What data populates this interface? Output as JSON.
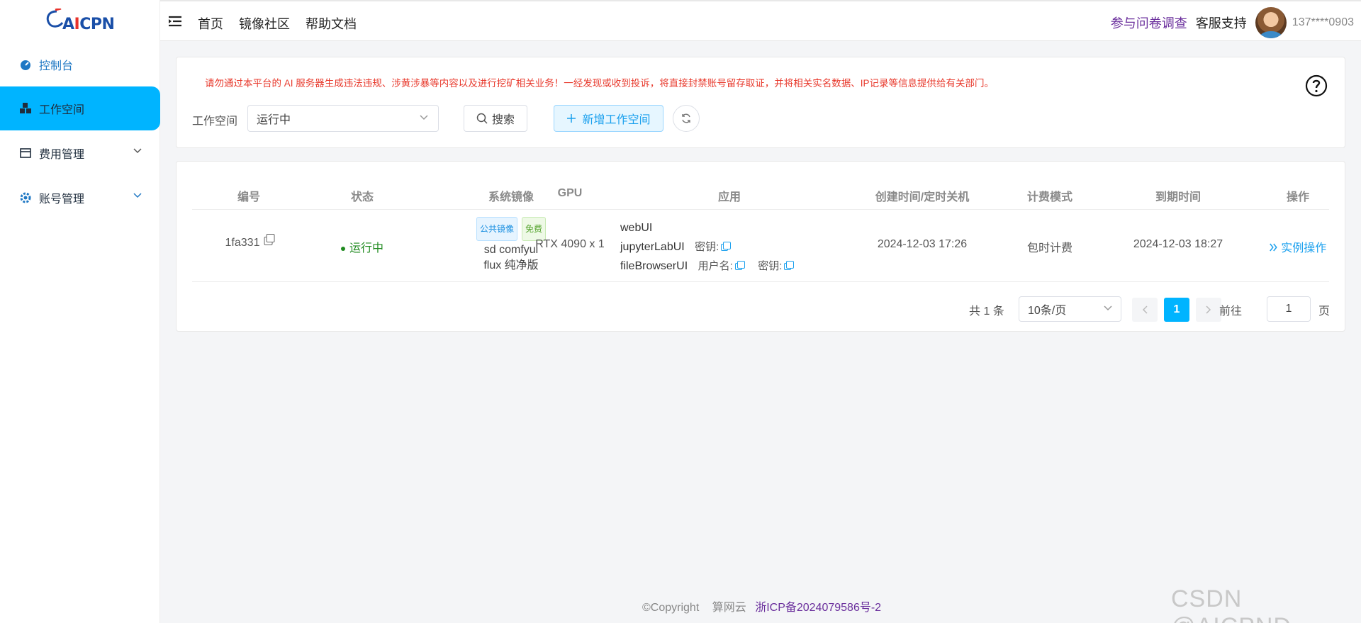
{
  "brand": {
    "logo_prefix": "A",
    "logo_red": "I",
    "logo_rest": "CPN"
  },
  "sidebar": {
    "items": [
      {
        "label": "控制台",
        "icon": "dashboard-icon"
      },
      {
        "label": "工作空间",
        "icon": "workspace-icon",
        "active": true
      },
      {
        "label": "费用管理",
        "icon": "billing-icon",
        "expandable": true
      },
      {
        "label": "账号管理",
        "icon": "settings-icon",
        "expandable": true
      }
    ]
  },
  "header": {
    "nav": [
      "首页",
      "镜像社区",
      "帮助文档"
    ],
    "survey": "参与问卷调查",
    "support": "客服支持",
    "user": "137****0903"
  },
  "filter": {
    "warning": "请勿通过本平台的 AI 服务器生成违法违规、涉黄涉暴等内容以及进行挖矿相关业务！一经发现或收到投诉，将直接封禁账号留存取证，并将相关实名数据、IP记录等信息提供给有关部门。",
    "label": "工作空间",
    "status_value": "运行中",
    "search_label": "搜索",
    "add_label": "新增工作空间"
  },
  "table": {
    "columns": [
      "编号",
      "状态",
      "系统镜像",
      "GPU",
      "应用",
      "创建时间/定时关机",
      "计费模式",
      "到期时间",
      "操作"
    ],
    "rows": [
      {
        "id": "1fa331",
        "status": "运行中",
        "image_tags": [
          "公共镜像",
          "免费"
        ],
        "image_line1": "sd comfyui",
        "image_line2": "flux 纯净版",
        "gpu": "RTX 4090 x 1",
        "apps": {
          "app1": "webUI",
          "app2": "jupyterLabUI",
          "app2_key": "密钥:",
          "app3": "fileBrowserUI",
          "app3_user": "用户名:",
          "app3_key": "密钥:"
        },
        "created": "2024-12-03 17:26",
        "billing": "包时计费",
        "expire": "2024-12-03 18:27",
        "action": "实例操作"
      }
    ]
  },
  "pagination": {
    "total": "共 1 条",
    "page_size": "10条/页",
    "current": "1",
    "goto_label": "前往",
    "goto_value": "1",
    "page_suffix": "页"
  },
  "footer": {
    "copyright": "©Copyright",
    "company": "算网云",
    "icp": "浙ICP备2024079586号-2"
  },
  "watermark": "CSDN @AICPND",
  "colors": {
    "accent": "#00b4ff",
    "warning": "#e83a2d",
    "running": "#1f8a1f",
    "link": "#1aa0ee",
    "survey": "#6a2e9c"
  }
}
